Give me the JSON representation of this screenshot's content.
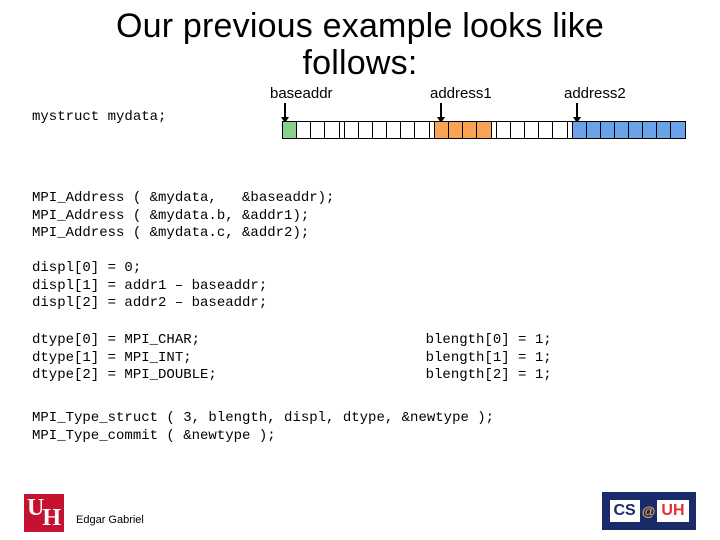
{
  "title_line1": "Our previous example looks like",
  "title_line2": "follows:",
  "struct_decl": "mystruct mydata;",
  "labels": {
    "baseaddr": "baseaddr",
    "address1": "address1",
    "address2": "address2"
  },
  "memory": {
    "seg_char_cells": 1,
    "seg_pad1_cells": 3,
    "seg_pad2_cells": 6,
    "seg_int_cells": 4,
    "seg_pad3_cells": 5,
    "seg_dbl_cells": 8
  },
  "code1": "MPI_Address ( &mydata,   &baseaddr);\nMPI_Address ( &mydata.b, &addr1);\nMPI_Address ( &mydata.c, &addr2);",
  "code2": "displ[0] = 0;\ndispl[1] = addr1 – baseaddr;\ndispl[2] = addr2 – baseaddr;",
  "code3_left": "dtype[0] = MPI_CHAR;\ndtype[1] = MPI_INT;\ndtype[2] = MPI_DOUBLE;",
  "code3_right": "    blength[0] = 1;\nblength[1] = 1;\nblength[2] = 1;",
  "code4": "MPI_Type_struct ( 3, blength, displ, dtype, &newtype );\nMPI_Type_commit ( &newtype );",
  "footer": {
    "author": "Edgar Gabriel",
    "uh_u": "U",
    "uh_h": "H",
    "cs": "CS",
    "at": "@",
    "uh": "UH"
  }
}
